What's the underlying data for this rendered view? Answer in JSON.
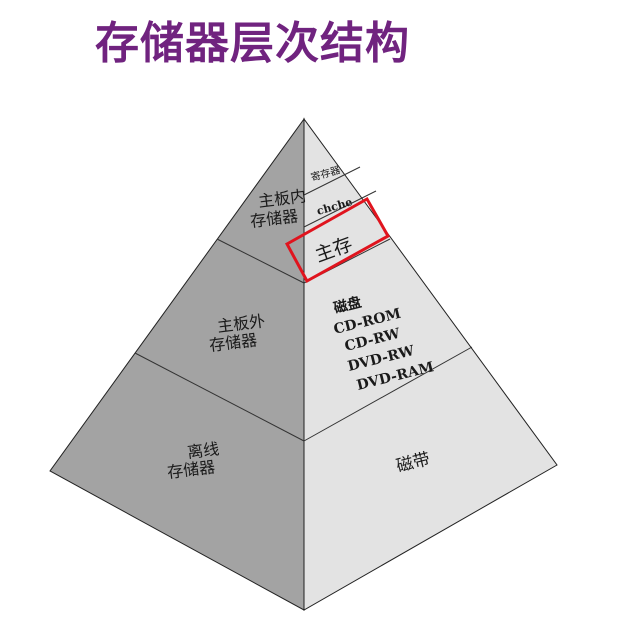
{
  "title": "存储器层次结构",
  "left_face": {
    "tier1": [
      "主板内",
      "存储器"
    ],
    "tier2": [
      "主板外",
      "存储器"
    ],
    "tier3": [
      "离线",
      "存储器"
    ]
  },
  "right_face": {
    "register": "寄存器",
    "cache": "chche",
    "main_memory": "主存",
    "disk_title": "磁盘",
    "disk_items": [
      "CD-ROM",
      "CD-RW",
      "DVD-RW",
      "DVD-RAM"
    ],
    "tape": "磁带"
  },
  "colors": {
    "title": "#70237f",
    "left_face": "#a3a3a3",
    "right_face": "#e3e3e3",
    "highlight": "#e0141e"
  }
}
